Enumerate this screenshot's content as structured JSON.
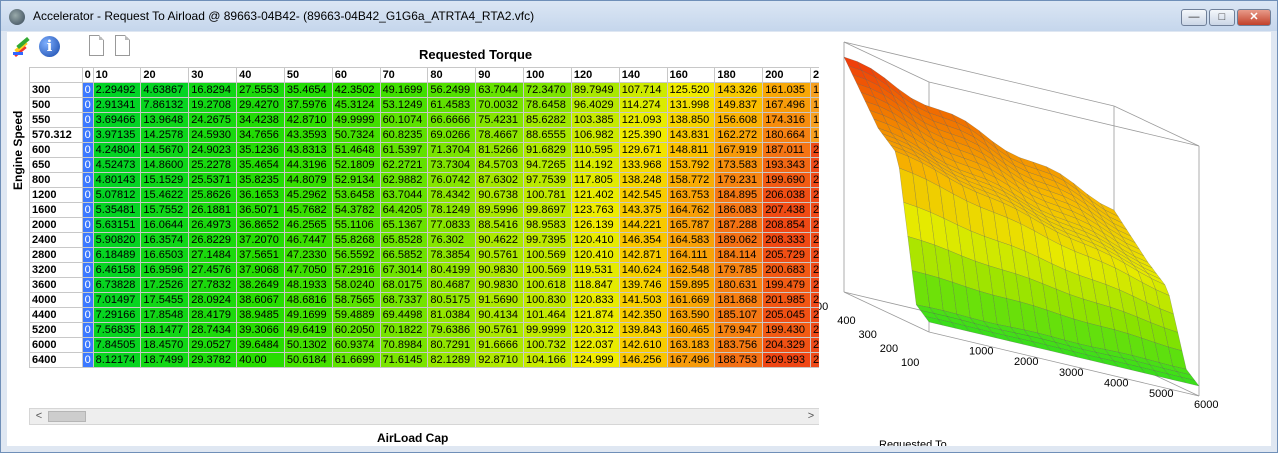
{
  "window": {
    "title": "Accelerator - Request To Airload @ 89663-04B42- (89663-04B42_G1G6a_ATRTA4_RTA2.vfc)",
    "controls": {
      "minimize": "—",
      "maximize": "□",
      "close": "✕"
    }
  },
  "toolbar": {
    "icons": [
      "pens-icon",
      "info-icon",
      "document-icon",
      "document-icon"
    ],
    "info_glyph": "i"
  },
  "table": {
    "top_axis_title": "Requested Torque",
    "left_axis_title": "Engine Speed",
    "bottom_axis_title": "AirLoad Cap",
    "columns": [
      "0",
      "10",
      "20",
      "30",
      "40",
      "50",
      "60",
      "70",
      "80",
      "90",
      "100",
      "120",
      "140",
      "160",
      "180",
      "200",
      "2"
    ],
    "rows": [
      "300",
      "500",
      "550",
      "570.312",
      "600",
      "650",
      "800",
      "1200",
      "1600",
      "2000",
      "2400",
      "2800",
      "3200",
      "3600",
      "4000",
      "4400",
      "5200",
      "6000",
      "6400"
    ],
    "cells": [
      [
        "0",
        "2.29492",
        "4.63867",
        "16.8294",
        "27.5553",
        "35.4654",
        "42.3502",
        "49.1699",
        "56.2499",
        "63.7044",
        "72.3470",
        "89.7949",
        "107.714",
        "125.520",
        "143.326",
        "161.035",
        "1"
      ],
      [
        "0",
        "2.91341",
        "7.86132",
        "19.2708",
        "29.4270",
        "37.5976",
        "45.3124",
        "53.1249",
        "61.4583",
        "70.0032",
        "78.6458",
        "96.4029",
        "114.274",
        "131.998",
        "149.837",
        "167.496",
        "1"
      ],
      [
        "0",
        "3.69466",
        "13.9648",
        "24.2675",
        "34.4238",
        "42.8710",
        "49.9999",
        "60.1074",
        "66.6666",
        "75.4231",
        "85.6282",
        "103.385",
        "121.093",
        "138.850",
        "156.608",
        "174.316",
        "1"
      ],
      [
        "0",
        "3.97135",
        "14.2578",
        "24.5930",
        "34.7656",
        "43.3593",
        "50.7324",
        "60.8235",
        "69.0266",
        "78.4667",
        "88.6555",
        "106.982",
        "125.390",
        "143.831",
        "162.272",
        "180.664",
        "1"
      ],
      [
        "0",
        "4.24804",
        "14.5670",
        "24.9023",
        "35.1236",
        "43.8313",
        "51.4648",
        "61.5397",
        "71.3704",
        "81.5266",
        "91.6829",
        "110.595",
        "129.671",
        "148.811",
        "167.919",
        "187.011",
        "2"
      ],
      [
        "0",
        "4.52473",
        "14.8600",
        "25.2278",
        "35.4654",
        "44.3196",
        "52.1809",
        "62.2721",
        "73.7304",
        "84.5703",
        "94.7265",
        "114.192",
        "133.968",
        "153.792",
        "173.583",
        "193.343",
        "2"
      ],
      [
        "0",
        "4.80143",
        "15.1529",
        "25.5371",
        "35.8235",
        "44.8079",
        "52.9134",
        "62.9882",
        "76.0742",
        "87.6302",
        "97.7539",
        "117.805",
        "138.248",
        "158.772",
        "179.231",
        "199.690",
        "2"
      ],
      [
        "0",
        "5.07812",
        "15.4622",
        "25.8626",
        "36.1653",
        "45.2962",
        "53.6458",
        "63.7044",
        "78.4342",
        "90.6738",
        "100.781",
        "121.402",
        "142.545",
        "163.753",
        "184.895",
        "206.038",
        "2"
      ],
      [
        "0",
        "5.35481",
        "15.7552",
        "26.1881",
        "36.5071",
        "45.7682",
        "54.3782",
        "64.4205",
        "78.1249",
        "89.5996",
        "99.8697",
        "123.763",
        "143.375",
        "164.762",
        "186.083",
        "207.438",
        "2"
      ],
      [
        "0",
        "5.63151",
        "16.0644",
        "26.4973",
        "36.8652",
        "46.2565",
        "55.1106",
        "65.1367",
        "77.0833",
        "88.5416",
        "98.9583",
        "126.139",
        "144.221",
        "165.787",
        "187.288",
        "208.854",
        "2"
      ],
      [
        "0",
        "5.90820",
        "16.3574",
        "26.8229",
        "37.2070",
        "46.7447",
        "55.8268",
        "65.8528",
        "76.302",
        "90.4622",
        "99.7395",
        "120.410",
        "146.354",
        "164.583",
        "189.062",
        "208.333",
        "2"
      ],
      [
        "0",
        "6.18489",
        "16.6503",
        "27.1484",
        "37.5651",
        "47.2330",
        "56.5592",
        "66.5852",
        "78.3854",
        "90.5761",
        "100.569",
        "120.410",
        "142.871",
        "164.111",
        "184.114",
        "205.729",
        "2"
      ],
      [
        "0",
        "6.46158",
        "16.9596",
        "27.4576",
        "37.9068",
        "47.7050",
        "57.2916",
        "67.3014",
        "80.4199",
        "90.9830",
        "100.569",
        "119.531",
        "140.624",
        "162.548",
        "179.785",
        "200.683",
        "2"
      ],
      [
        "0",
        "6.73828",
        "17.2526",
        "27.7832",
        "38.2649",
        "48.1933",
        "58.0240",
        "68.0175",
        "80.4687",
        "90.9830",
        "100.618",
        "118.847",
        "139.746",
        "159.895",
        "180.631",
        "199.479",
        "2"
      ],
      [
        "0",
        "7.01497",
        "17.5455",
        "28.0924",
        "38.6067",
        "48.6816",
        "58.7565",
        "68.7337",
        "80.5175",
        "91.5690",
        "100.830",
        "120.833",
        "141.503",
        "161.669",
        "181.868",
        "201.985",
        "2"
      ],
      [
        "0",
        "7.29166",
        "17.8548",
        "28.4179",
        "38.9485",
        "49.1699",
        "59.4889",
        "69.4498",
        "81.0384",
        "90.4134",
        "101.464",
        "121.874",
        "142.350",
        "163.590",
        "185.107",
        "205.045",
        "2"
      ],
      [
        "0",
        "7.56835",
        "18.1477",
        "28.7434",
        "39.3066",
        "49.6419",
        "60.2050",
        "70.1822",
        "79.6386",
        "90.5761",
        "99.9999",
        "120.312",
        "139.843",
        "160.465",
        "179.947",
        "199.430",
        "2"
      ],
      [
        "0",
        "7.84505",
        "18.4570",
        "29.0527",
        "39.6484",
        "50.1302",
        "60.9374",
        "70.8984",
        "80.7291",
        "91.6666",
        "100.732",
        "122.037",
        "142.610",
        "163.183",
        "183.756",
        "204.329",
        "2"
      ],
      [
        "0",
        "8.12174",
        "18.7499",
        "29.3782",
        "40.00",
        "50.6184",
        "61.6699",
        "71.6145",
        "82.1289",
        "92.8710",
        "104.166",
        "124.999",
        "146.256",
        "167.496",
        "188.753",
        "209.993",
        "2"
      ]
    ]
  },
  "plot": {
    "x_ticks": [
      "1000",
      "2000",
      "3000",
      "4000",
      "5000",
      "6000"
    ],
    "y_ticks": [
      "00",
      "400",
      "300",
      "200",
      "100"
    ],
    "axis_label_fragment": "Requested To",
    "gradient": [
      "#22dd22",
      "#88e200",
      "#e6ea00",
      "#f7b800",
      "#f07000",
      "#ee2010"
    ]
  },
  "scrollbar": {
    "left_arrow": "<",
    "right_arrow": ">"
  }
}
